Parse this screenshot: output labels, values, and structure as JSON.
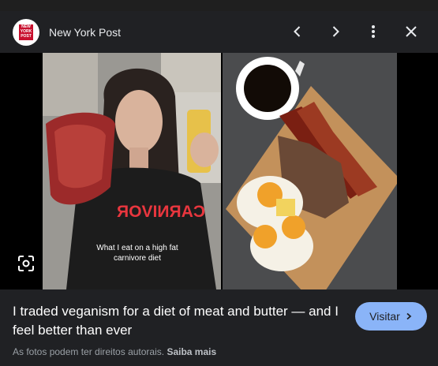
{
  "header": {
    "source_name": "New York Post",
    "logo_text": [
      "NEW",
      "YORK",
      "POST"
    ],
    "icons": [
      "previous-icon",
      "next-icon",
      "more-vert-icon",
      "close-icon"
    ]
  },
  "image": {
    "shirt_text": "CARNIVOR",
    "caption_line1": "What I eat on a high fat",
    "caption_line2": "carnivore diet"
  },
  "result": {
    "title": "I traded veganism for a diet of meat and butter — and I feel better than ever",
    "visit_label": "Visitar",
    "copyright_text": "As fotos podem ter direitos autorais.",
    "learn_more": "Saiba mais"
  },
  "colors": {
    "background": "#1f1f1f",
    "bar": "#202124",
    "button": "#8ab4f8",
    "text_secondary": "#9aa0a6",
    "logo_red": "#c8102e"
  }
}
